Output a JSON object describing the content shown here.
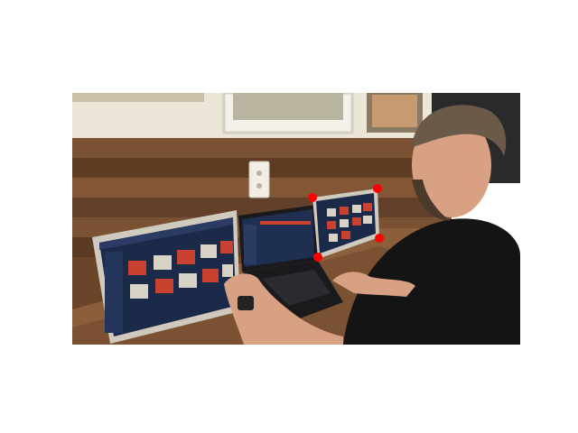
{
  "scene": {
    "description_tags": [
      "photo",
      "laptop",
      "portable-monitors",
      "wood-wall",
      "man"
    ],
    "colors": {
      "wood_dark": "#5a3a22",
      "wood_mid": "#7a5132",
      "wood_light": "#9a6a43",
      "wall": "#e8e2d4",
      "screen_bg": "#1c2a4a",
      "screen_panel": "#2b3b63",
      "thumb_red": "#c9412f",
      "thumb_light": "#d9d3c7",
      "frame_silver": "#cfcabd",
      "laptop_black": "#1a1a1c",
      "shirt_black": "#141414",
      "skin": "#d9a184",
      "hair": "#6b5a48",
      "marker_red": "#ff0000"
    }
  },
  "markers": [
    {
      "name": "corner-top-left"
    },
    {
      "name": "corner-top-right"
    },
    {
      "name": "corner-bottom-right"
    },
    {
      "name": "corner-bottom-left"
    }
  ]
}
